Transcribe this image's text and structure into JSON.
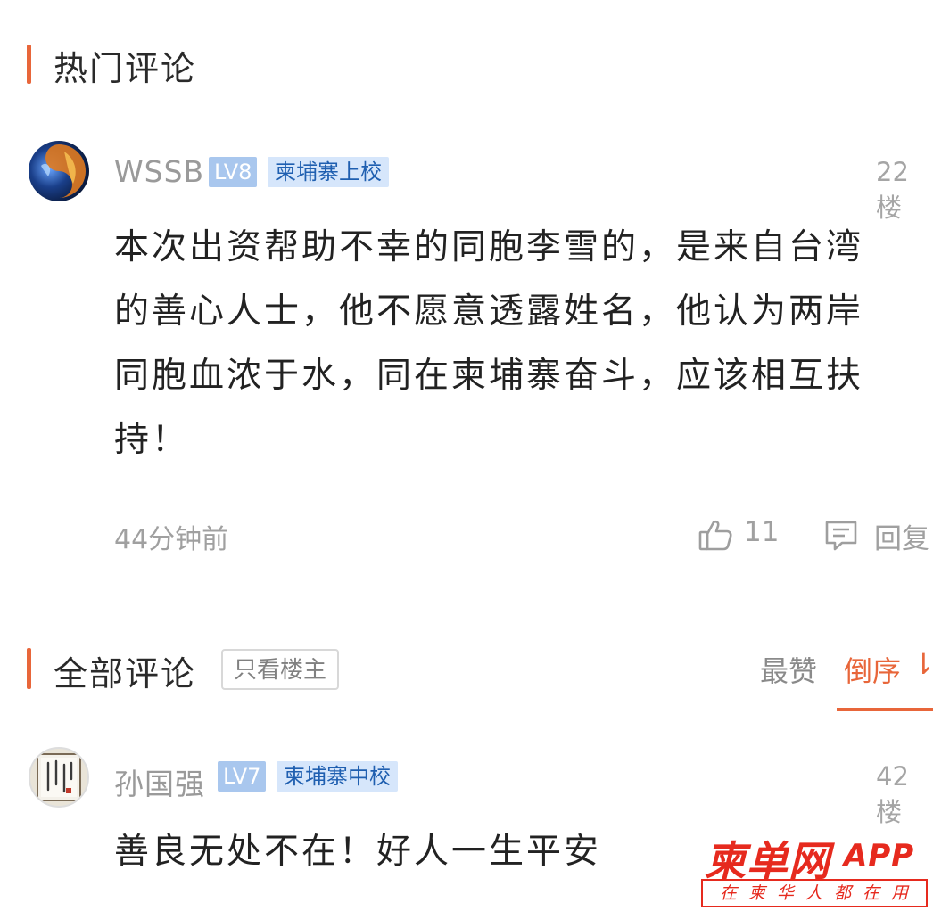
{
  "hot_section": {
    "title": "热门评论",
    "comment": {
      "username": "WSSB",
      "level": "LV8",
      "rank": "柬埔寨上校",
      "floor": "22楼",
      "content": "本次出资帮助不幸的同胞李雪的，是来自台湾的善心人士，他不愿意透露姓名，他认为两岸同胞血浓于水，同在柬埔寨奋斗，应该相互扶持！",
      "time": "44分钟前",
      "likes": "11",
      "reply_label": "回复"
    }
  },
  "all_section": {
    "title": "全部评论",
    "filter_button": "只看楼主",
    "sort_hot": "最赞",
    "sort_desc": "倒序",
    "sort_icon": "⇂",
    "comment": {
      "username": "孙国强",
      "level": "LV7",
      "rank": "柬埔寨中校",
      "floor": "42楼",
      "content": "善良无处不在！好人一生平安"
    }
  },
  "watermark": {
    "brand": "柬单网",
    "app": "APP",
    "tagline": "在柬华人都在用"
  },
  "colors": {
    "accent": "#e8663a",
    "brand_red": "#e62a1e",
    "level_badge": "#a9c7ee",
    "rank_badge_bg": "#d6e6fb"
  },
  "icons": [
    "thumbs-up-icon",
    "comment-icon",
    "sort-desc-icon"
  ]
}
